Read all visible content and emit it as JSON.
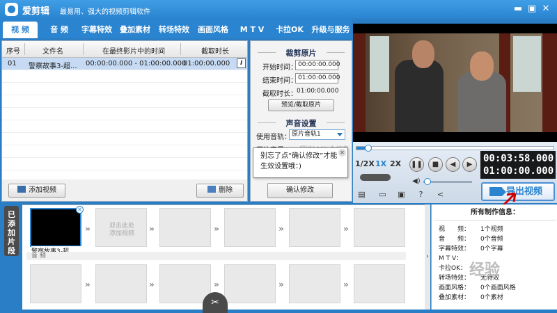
{
  "app": {
    "title": "爱剪辑",
    "slogan": "最易用、强大的视频剪辑软件"
  },
  "tabs": [
    "视 频",
    "音 频",
    "字幕特效",
    "叠加素材",
    "转场特效",
    "画面风格",
    "M T V",
    "卡拉OK",
    "升级与服务"
  ],
  "active_tab": "视 频",
  "clip_table": {
    "columns": [
      "序号",
      "文件名",
      "在最终影片中的时间",
      "截取时长"
    ],
    "rows": [
      {
        "index": "01",
        "filename": "警察故事3-超...",
        "time_range": "00:00:00.000 - 01:00:00.000",
        "duration": "01:00:00.000"
      }
    ]
  },
  "list_footer": {
    "add_video": "添加视频",
    "delete": "删除"
  },
  "trim": {
    "section_title": "裁剪原片",
    "start_label": "开始时间：",
    "start_value": "00:00:00.000",
    "end_label": "结束时间：",
    "end_value": "01:00:00.000",
    "duration_label": "截取时长：",
    "duration_value": "01:00:00.000",
    "preview_button": "预览/截取原片"
  },
  "audio": {
    "section_title": "声音设置",
    "track_label": "使用音轨：",
    "track_value": "原片音轨1",
    "volume_label": "原片音量：",
    "volume_hint": "超过100%为扩音"
  },
  "tooltip": {
    "text_line1": "别忘了点“确认修改”才能",
    "text_line2": "生效设置哦：)"
  },
  "confirm_button": "确认修改",
  "player": {
    "speeds": [
      "1/2X",
      "1X",
      "2X"
    ],
    "active_speed": "1X",
    "current_time": "00:03:58.000",
    "total_time": "01:00:00.000",
    "progress": 0.06,
    "volume": 0.05,
    "export_label": "导出视频"
  },
  "timeline": {
    "side_tab": "已添加片段",
    "clips": [
      {
        "label": "警察故事3-超...",
        "filled": true
      },
      {
        "hint": "双击此处\n添加视频"
      }
    ],
    "audio_label": "音 频"
  },
  "info": {
    "title": "所有制作信息：",
    "items": [
      {
        "label": "视　　频：",
        "value": "1个视频"
      },
      {
        "label": "音　　频：",
        "value": "0个音频"
      },
      {
        "label": "字幕特效：",
        "value": "0个字幕"
      },
      {
        "label": "M T V：",
        "value": ""
      },
      {
        "label": "卡拉OK：",
        "value": ""
      },
      {
        "label": "转场特效：",
        "value": "无特效"
      },
      {
        "label": "画面风格：",
        "value": "0个画面风格"
      },
      {
        "label": "叠加素材：",
        "value": "0个素材"
      }
    ]
  },
  "watermark": "经验"
}
